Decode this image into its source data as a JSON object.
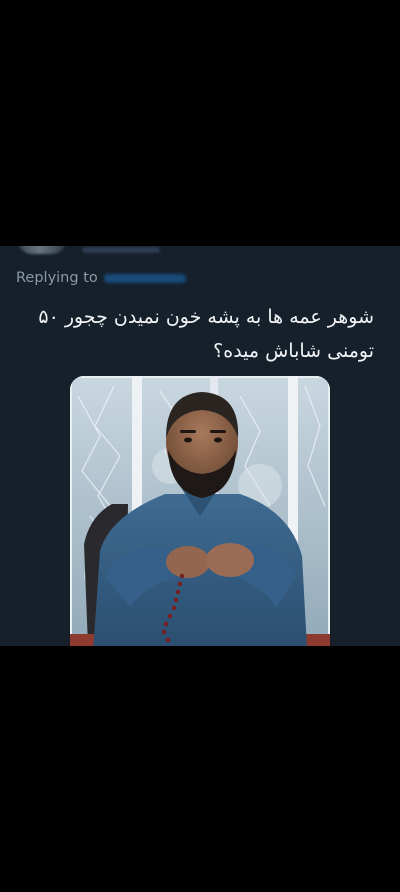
{
  "reply_header": {
    "replying_label": "Replying to"
  },
  "tweet": {
    "line1": "شوهر عمه ها به پشه خون نمیدن چجور ۵۰",
    "line2": "تومنی شاباش میده؟"
  },
  "colors": {
    "background": "#000000",
    "card": "#15202b",
    "text": "#f2f4f6",
    "muted": "#8b98a5"
  }
}
